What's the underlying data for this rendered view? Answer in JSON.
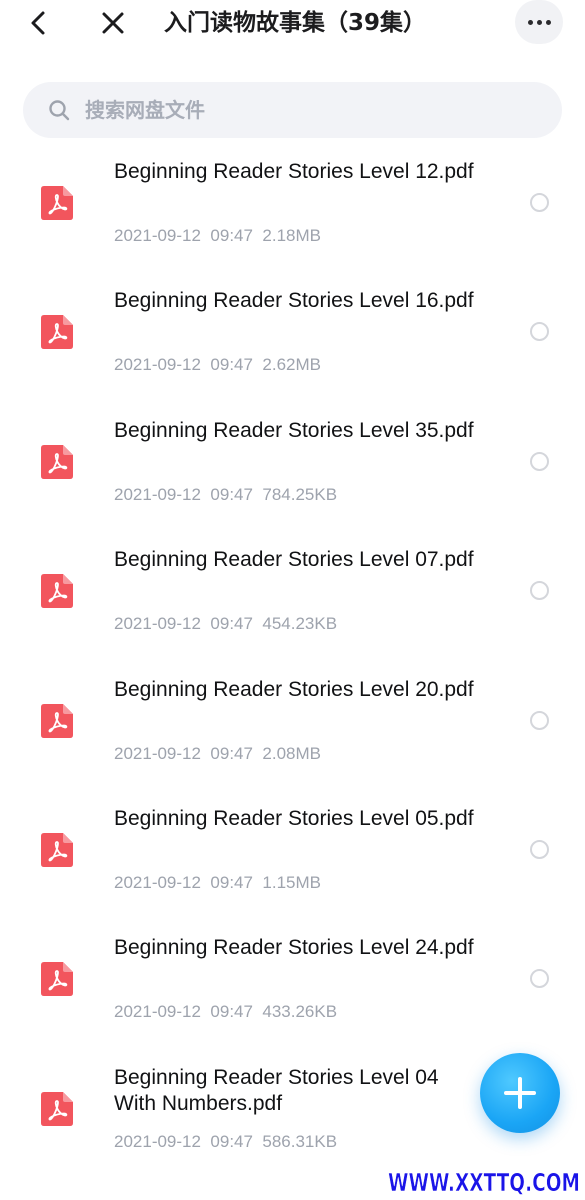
{
  "header": {
    "title": "入门读物故事集（39集）",
    "back_icon": "chevron-left-icon",
    "close_icon": "close-icon",
    "more_icon": "more-horizontal-icon"
  },
  "search": {
    "placeholder": "搜索网盘文件",
    "value": "",
    "icon": "search-icon"
  },
  "files": [
    {
      "name": "Beginning Reader Stories Level 12.pdf",
      "date": "2021-09-12",
      "time": "09:47",
      "size": "2.18MB",
      "type": "pdf"
    },
    {
      "name": "Beginning Reader Stories Level 16.pdf",
      "date": "2021-09-12",
      "time": "09:47",
      "size": "2.62MB",
      "type": "pdf"
    },
    {
      "name": "Beginning Reader Stories Level 35.pdf",
      "date": "2021-09-12",
      "time": "09:47",
      "size": "784.25KB",
      "type": "pdf"
    },
    {
      "name": "Beginning Reader Stories Level 07.pdf",
      "date": "2021-09-12",
      "time": "09:47",
      "size": "454.23KB",
      "type": "pdf"
    },
    {
      "name": "Beginning Reader Stories Level 20.pdf",
      "date": "2021-09-12",
      "time": "09:47",
      "size": "2.08MB",
      "type": "pdf"
    },
    {
      "name": "Beginning Reader Stories Level 05.pdf",
      "date": "2021-09-12",
      "time": "09:47",
      "size": "1.15MB",
      "type": "pdf"
    },
    {
      "name": "Beginning Reader Stories Level 24.pdf",
      "date": "2021-09-12",
      "time": "09:47",
      "size": "433.26KB",
      "type": "pdf"
    },
    {
      "name": "Beginning Reader Stories Level 04 With Numbers.pdf",
      "date": "2021-09-12",
      "time": "09:47",
      "size": "586.31KB",
      "type": "pdf"
    }
  ],
  "fab": {
    "icon": "plus-icon"
  },
  "watermark": {
    "text": "WWW.XXTTQ.COM"
  },
  "colors": {
    "pdf_icon": "#f2555d",
    "fab": "#1aa5f5",
    "meta_text": "#9ea3ad",
    "search_bg": "#f2f3f7",
    "watermark": "#1a14e8"
  }
}
